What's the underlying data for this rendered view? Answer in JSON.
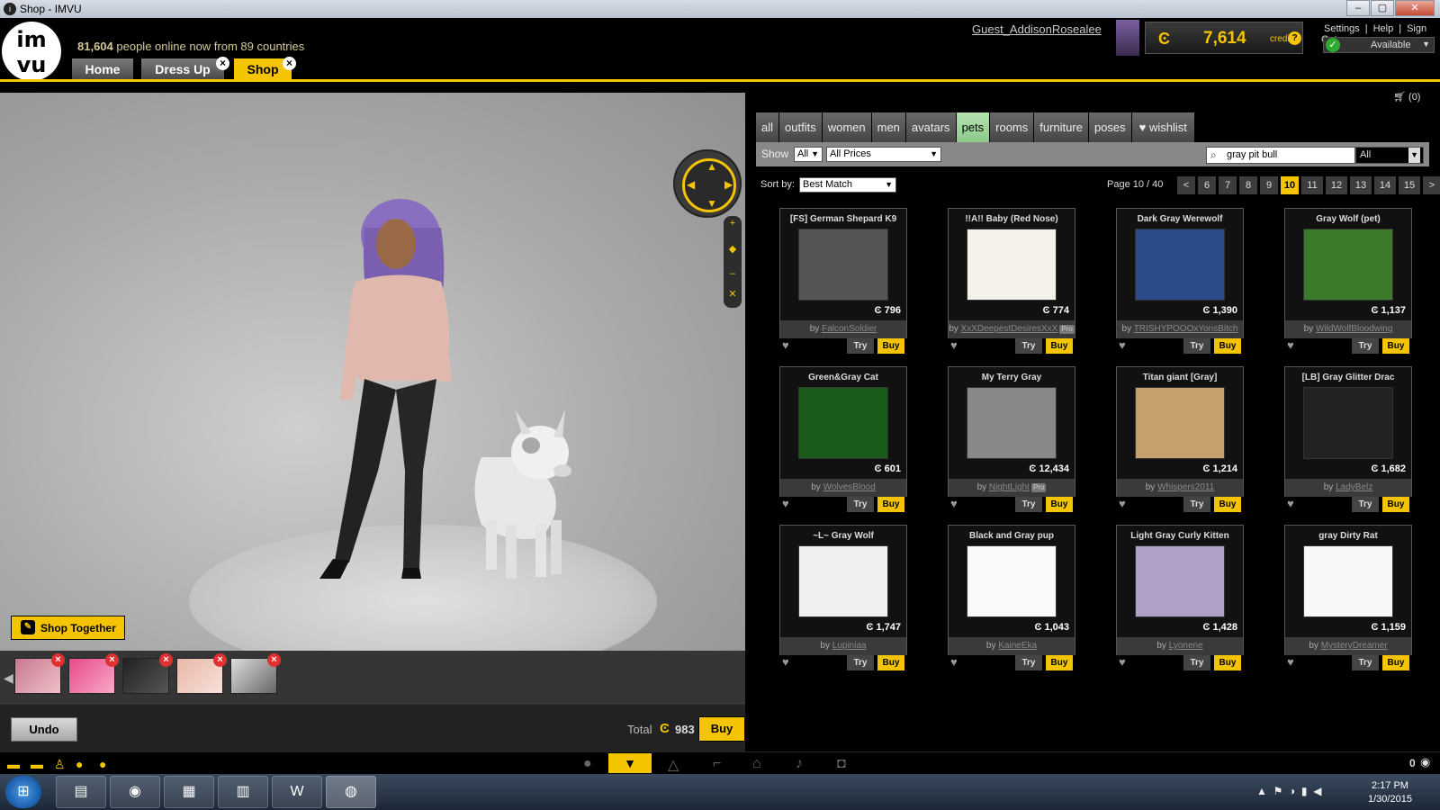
{
  "window": {
    "title": "Shop - IMVU",
    "minimize": "–",
    "maximize": "▢",
    "close": "✕"
  },
  "header": {
    "logo": "im vu",
    "online_count": "81,604",
    "online_text": "people online now from 89 countries",
    "username": "Guest_AddisonRosealee",
    "credits_value": "7,614",
    "credits_label": "credits",
    "credits_symbol": "Ͼ",
    "links": [
      "Settings",
      "|",
      "Help",
      "|",
      "Sign Out"
    ],
    "status": "Available",
    "nav": [
      {
        "label": "Home"
      },
      {
        "label": "Dress Up"
      },
      {
        "label": "Shop"
      }
    ]
  },
  "scene": {
    "shop_together": "Shop Together",
    "undo": "Undo",
    "total_label": "Total",
    "total_value": "983",
    "buy": "Buy"
  },
  "shop": {
    "cart": "(0)",
    "categories": [
      "all",
      "outfits",
      "women",
      "men",
      "avatars",
      "pets",
      "rooms",
      "furniture",
      "poses",
      "wishlist"
    ],
    "active_category": "pets",
    "show_label": "Show",
    "show_value": "All",
    "price_value": "All Prices",
    "search_value": "gray pit bull",
    "search_cat": "All",
    "sort_label": "Sort by:",
    "sort_value": "Best Match",
    "page_label": "Page 10 / 40",
    "pages": [
      "<",
      "6",
      "7",
      "8",
      "9",
      "10",
      "11",
      "12",
      "13",
      "14",
      "15",
      ">"
    ],
    "current_page": "10",
    "try_label": "Try",
    "buy_label": "Buy",
    "by_label": "by",
    "items": [
      {
        "title": "[FS] German Shepard K9",
        "price": "796",
        "creator": "FalconSoldier",
        "pro": false,
        "color": "#555555"
      },
      {
        "title": "!!A!! Baby (Red Nose)",
        "price": "774",
        "creator": "XxXDeepestDesiresXxX",
        "pro": true,
        "color": "#f4f0ea"
      },
      {
        "title": "Dark Gray Werewolf",
        "price": "1,390",
        "creator": "TRISHYPOOOxYonsBitch",
        "pro": false,
        "color": "#2a4a8a"
      },
      {
        "title": "Gray Wolf (pet)",
        "price": "1,137",
        "creator": "WildWolfBloodwing",
        "pro": false,
        "color": "#3a7a2a"
      },
      {
        "title": "Green&Gray Cat",
        "price": "601",
        "creator": "WolvesBlood",
        "pro": false,
        "color": "#1a5a1a"
      },
      {
        "title": "My Terry Gray",
        "price": "12,434",
        "creator": "NightLight",
        "pro": true,
        "color": "#888888"
      },
      {
        "title": "Titan giant [Gray]",
        "price": "1,214",
        "creator": "Whispers2011",
        "pro": false,
        "color": "#c8a070"
      },
      {
        "title": "[LB] Gray Glitter Drac",
        "price": "1,682",
        "creator": "LadyBelz",
        "pro": false,
        "color": "#222222"
      },
      {
        "title": "~L~ Gray Wolf",
        "price": "1,747",
        "creator": "Lupiniaa",
        "pro": false,
        "color": "#f0f0f0"
      },
      {
        "title": "Black and Gray pup",
        "price": "1,043",
        "creator": "KaineEka",
        "pro": false,
        "color": "#fafafa"
      },
      {
        "title": "Light Gray Curly Kitten",
        "price": "1,428",
        "creator": "Lyonene",
        "pro": false,
        "color": "#b0a0c8"
      },
      {
        "title": "gray Dirty Rat",
        "price": "1,159",
        "creator": "MysteryDreamer",
        "pro": false,
        "color": "#f8f8f8"
      }
    ]
  },
  "imvubar": {
    "count": "0"
  },
  "taskbar": {
    "time": "2:17 PM",
    "date": "1/30/2015"
  }
}
